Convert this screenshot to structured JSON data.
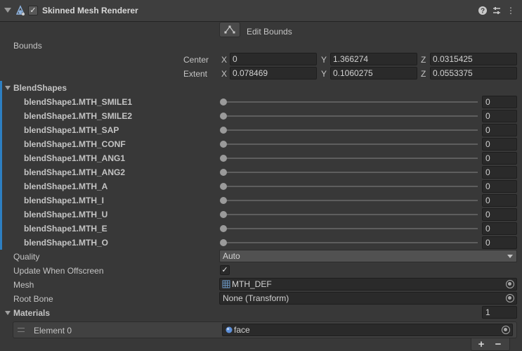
{
  "header": {
    "title": "Skinned Mesh Renderer",
    "enabled_mark": "✓",
    "help_icon": "?",
    "settings_icon": "⇵",
    "more_icon": "⋮"
  },
  "edit_bounds": {
    "label": "Edit Bounds"
  },
  "bounds": {
    "label": "Bounds",
    "center": {
      "label": "Center",
      "x_label": "X",
      "y_label": "Y",
      "z_label": "Z",
      "x": "0",
      "y": "1.366274",
      "z": "0.0315425"
    },
    "extent": {
      "label": "Extent",
      "x_label": "X",
      "y_label": "Y",
      "z_label": "Z",
      "x": "0.078469",
      "y": "0.1060275",
      "z": "0.0553375"
    }
  },
  "blendshapes": {
    "label": "BlendShapes",
    "items": [
      {
        "name": "blendShape1.MTH_SMILE1",
        "value": "0",
        "level": 0
      },
      {
        "name": "blendShape1.MTH_SMILE2",
        "value": "0",
        "level": 0
      },
      {
        "name": "blendShape1.MTH_SAP",
        "value": "0",
        "level": 0
      },
      {
        "name": "blendShape1.MTH_CONF",
        "value": "0",
        "level": 0
      },
      {
        "name": "blendShape1.MTH_ANG1",
        "value": "0",
        "level": 0
      },
      {
        "name": "blendShape1.MTH_ANG2",
        "value": "0",
        "level": 0
      },
      {
        "name": "blendShape1.MTH_A",
        "value": "0",
        "level": 0
      },
      {
        "name": "blendShape1.MTH_I",
        "value": "0",
        "level": 0
      },
      {
        "name": "blendShape1.MTH_U",
        "value": "0",
        "level": 0
      },
      {
        "name": "blendShape1.MTH_E",
        "value": "0",
        "level": 0
      },
      {
        "name": "blendShape1.MTH_O",
        "value": "0",
        "level": 0
      }
    ]
  },
  "quality": {
    "label": "Quality",
    "value": "Auto"
  },
  "update_offscreen": {
    "label": "Update When Offscreen",
    "checked_mark": "✓"
  },
  "mesh": {
    "label": "Mesh",
    "value": "MTH_DEF"
  },
  "root_bone": {
    "label": "Root Bone",
    "value": "None (Transform)"
  },
  "materials": {
    "label": "Materials",
    "count": "1",
    "elements": [
      {
        "label": "Element 0",
        "value": "face"
      }
    ],
    "add_label": "+",
    "remove_label": "−"
  },
  "colors": {
    "accent": "#2d7fc2",
    "background": "#383838",
    "field": "#2a2a2a"
  }
}
